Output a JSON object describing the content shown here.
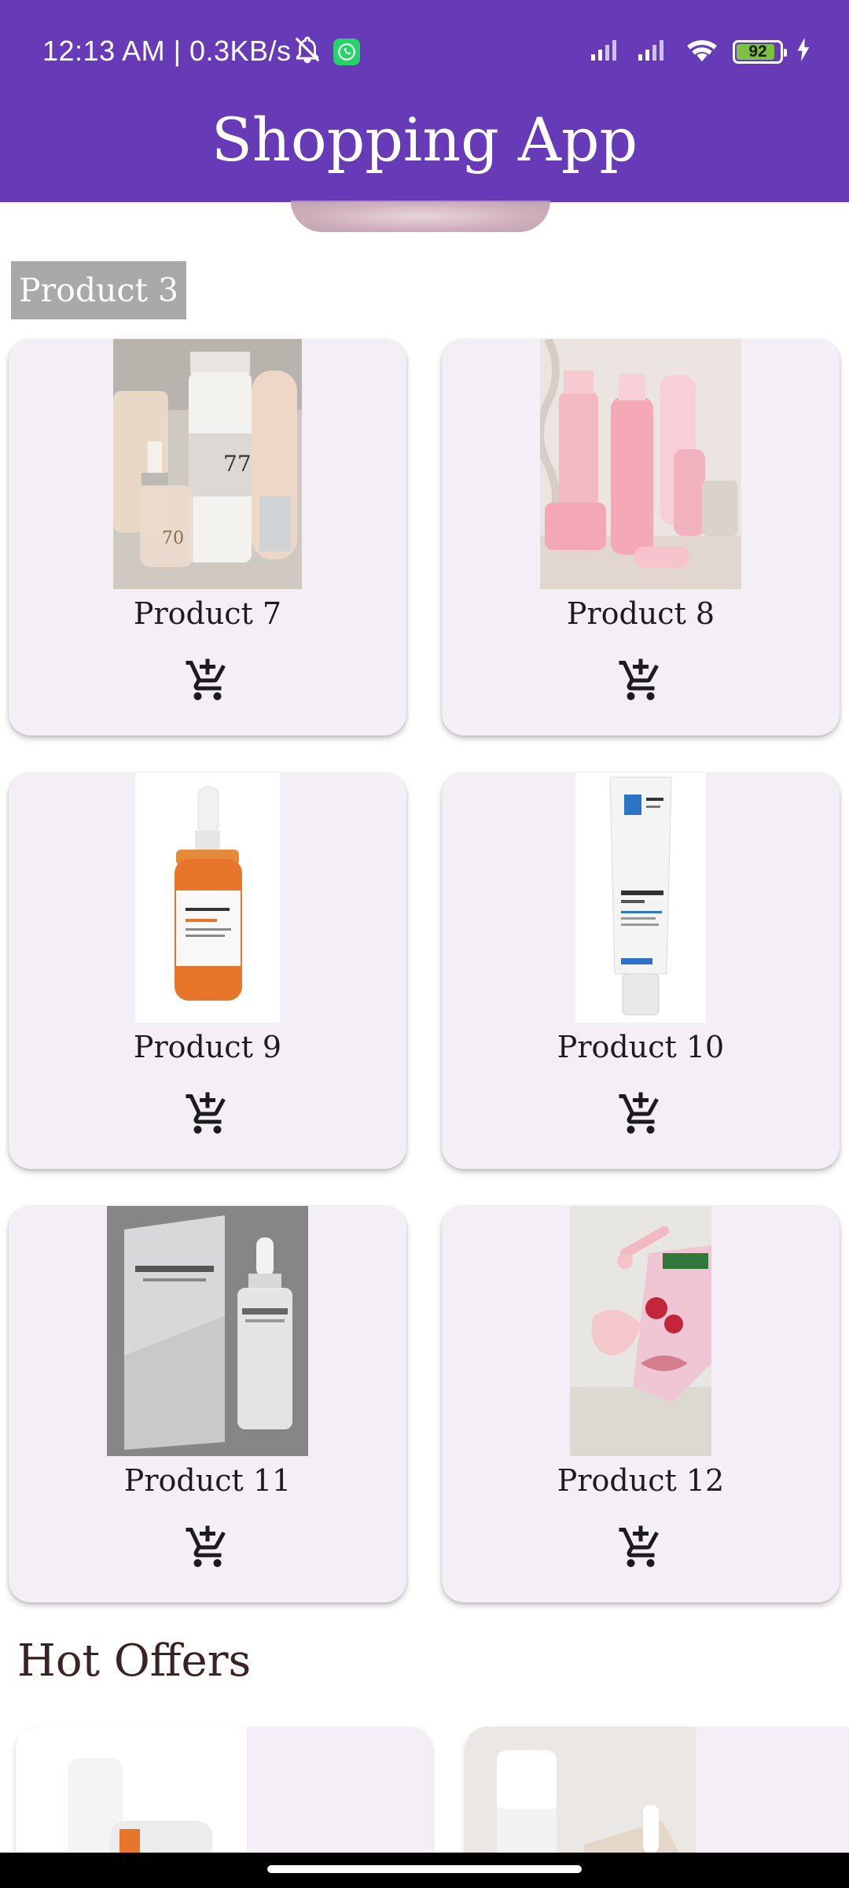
{
  "status_bar": {
    "time_speed": "12:13 AM | 0.3KB/s",
    "battery_level": "92",
    "battery_fill": 0.92,
    "icons": [
      "mute-bell-icon",
      "whatsapp-icon",
      "signal-icon",
      "signal-icon",
      "wifi-icon",
      "battery-icon",
      "charging-bolt-icon"
    ]
  },
  "app_bar": {
    "title": "Shopping App"
  },
  "carousel": {
    "current_label": "Product 3"
  },
  "products": [
    {
      "name": "Product 7",
      "image": "skincare-bottles-photo"
    },
    {
      "name": "Product 8",
      "image": "pink-skincare-photo"
    },
    {
      "name": "Product 9",
      "image": "vitamin-c-serum-photo"
    },
    {
      "name": "Product 10",
      "image": "effaclar-tube-photo"
    },
    {
      "name": "Product 11",
      "image": "centella-ampoule-photo"
    },
    {
      "name": "Product 12",
      "image": "jade-roller-mask-photo"
    }
  ],
  "hot_offers": {
    "title": "Hot Offers"
  },
  "icons": {
    "add_to_cart": "add-shopping-cart-icon"
  },
  "colors": {
    "primary": "#673ab7",
    "card_background": "#f4eff6",
    "label_grey": "#a9a9a9",
    "section_title": "#3b2322"
  }
}
